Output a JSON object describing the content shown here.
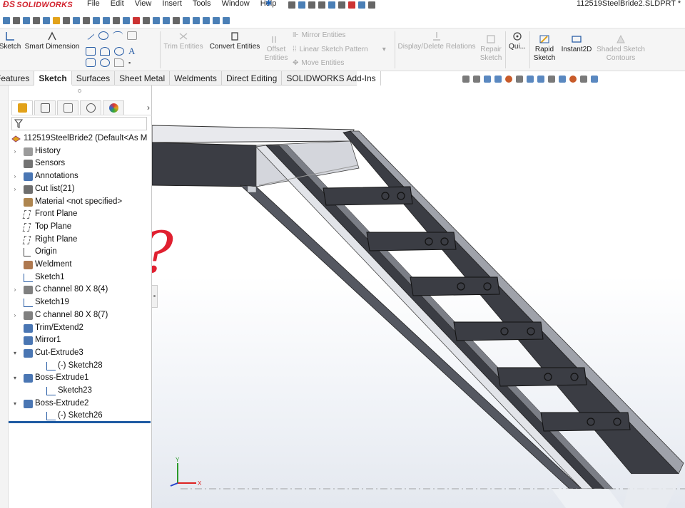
{
  "app": {
    "logo_text": "SOLIDWORKS",
    "menus": [
      "File",
      "Edit",
      "View",
      "Insert",
      "Tools",
      "Window",
      "Help"
    ],
    "document_title": "112519SteelBride2.SLDPRT *"
  },
  "ribbon": {
    "sketch": "Sketch",
    "smart_dimension": "Smart Dimension",
    "trim_entities": "Trim Entities",
    "convert_entities": "Convert Entities",
    "offset_entities_1": "Offset",
    "offset_entities_2": "Entities",
    "mirror_entities": "Mirror Entities",
    "linear_sketch_pattern": "Linear Sketch Pattern",
    "move_entities": "Move Entities",
    "display_delete_relations": "Display/Delete Relations",
    "repair_sketch_1": "Repair",
    "repair_sketch_2": "Sketch",
    "quick_snaps": "Qui...",
    "rapid_sketch_1": "Rapid",
    "rapid_sketch_2": "Sketch",
    "instant2d": "Instant2D",
    "shaded_sketch_contours_1": "Shaded Sketch",
    "shaded_sketch_contours_2": "Contours"
  },
  "tabs": [
    {
      "label": "Features",
      "active": false
    },
    {
      "label": "Sketch",
      "active": true
    },
    {
      "label": "Surfaces",
      "active": false
    },
    {
      "label": "Sheet Metal",
      "active": false
    },
    {
      "label": "Weldments",
      "active": false
    },
    {
      "label": "Direct Editing",
      "active": false
    },
    {
      "label": "SOLIDWORKS Add-Ins",
      "active": false
    }
  ],
  "feature_tree": {
    "root": "112519SteelBride2  (Default<As M",
    "items": [
      {
        "label": "History",
        "icon": "history-folder-icon",
        "expandable": true,
        "indent": 0
      },
      {
        "label": "Sensors",
        "icon": "sensors-icon",
        "expandable": false,
        "indent": 0
      },
      {
        "label": "Annotations",
        "icon": "annotations-icon",
        "expandable": true,
        "indent": 0
      },
      {
        "label": "Cut list(21)",
        "icon": "cut-list-icon",
        "expandable": true,
        "indent": 0
      },
      {
        "label": "Material <not specified>",
        "icon": "material-icon",
        "expandable": false,
        "indent": 0
      },
      {
        "label": "Front Plane",
        "icon": "plane-icon",
        "expandable": false,
        "indent": 0
      },
      {
        "label": "Top Plane",
        "icon": "plane-icon",
        "expandable": false,
        "indent": 0
      },
      {
        "label": "Right Plane",
        "icon": "plane-icon",
        "expandable": false,
        "indent": 0
      },
      {
        "label": "Origin",
        "icon": "origin-icon",
        "expandable": false,
        "indent": 0
      },
      {
        "label": "Weldment",
        "icon": "weldment-icon",
        "expandable": false,
        "indent": 0
      },
      {
        "label": "Sketch1",
        "icon": "sketch-icon",
        "expandable": false,
        "indent": 0
      },
      {
        "label": "C channel 80 X 8(4)",
        "icon": "structural-member-icon",
        "expandable": true,
        "indent": 0
      },
      {
        "label": "Sketch19",
        "icon": "sketch-icon",
        "expandable": false,
        "indent": 0
      },
      {
        "label": "C channel 80 X 8(7)",
        "icon": "structural-member-icon",
        "expandable": true,
        "indent": 0
      },
      {
        "label": "Trim/Extend2",
        "icon": "trim-extend-icon",
        "expandable": false,
        "indent": 0
      },
      {
        "label": "Mirror1",
        "icon": "mirror-icon",
        "expandable": false,
        "indent": 0
      },
      {
        "label": "Cut-Extrude3",
        "icon": "cut-extrude-icon",
        "expandable": "open",
        "indent": 0
      },
      {
        "label": "(-) Sketch28",
        "icon": "sketch-icon",
        "expandable": false,
        "indent": 1
      },
      {
        "label": "Boss-Extrude1",
        "icon": "boss-extrude-icon",
        "expandable": "open",
        "indent": 0
      },
      {
        "label": "Sketch23",
        "icon": "sketch-icon",
        "expandable": false,
        "indent": 1
      },
      {
        "label": "Boss-Extrude2",
        "icon": "boss-extrude-icon",
        "expandable": "open",
        "indent": 0
      },
      {
        "label": "(-) Sketch26",
        "icon": "sketch-icon",
        "expandable": false,
        "indent": 1
      }
    ]
  },
  "viewport": {
    "annotation": "?",
    "triad_y": "Y",
    "triad_x": "X"
  },
  "colors": {
    "accent": "#1f5ba3",
    "logo": "#d2222d",
    "steel": "#3b3d44",
    "steel_light": "#e8e9ed"
  }
}
